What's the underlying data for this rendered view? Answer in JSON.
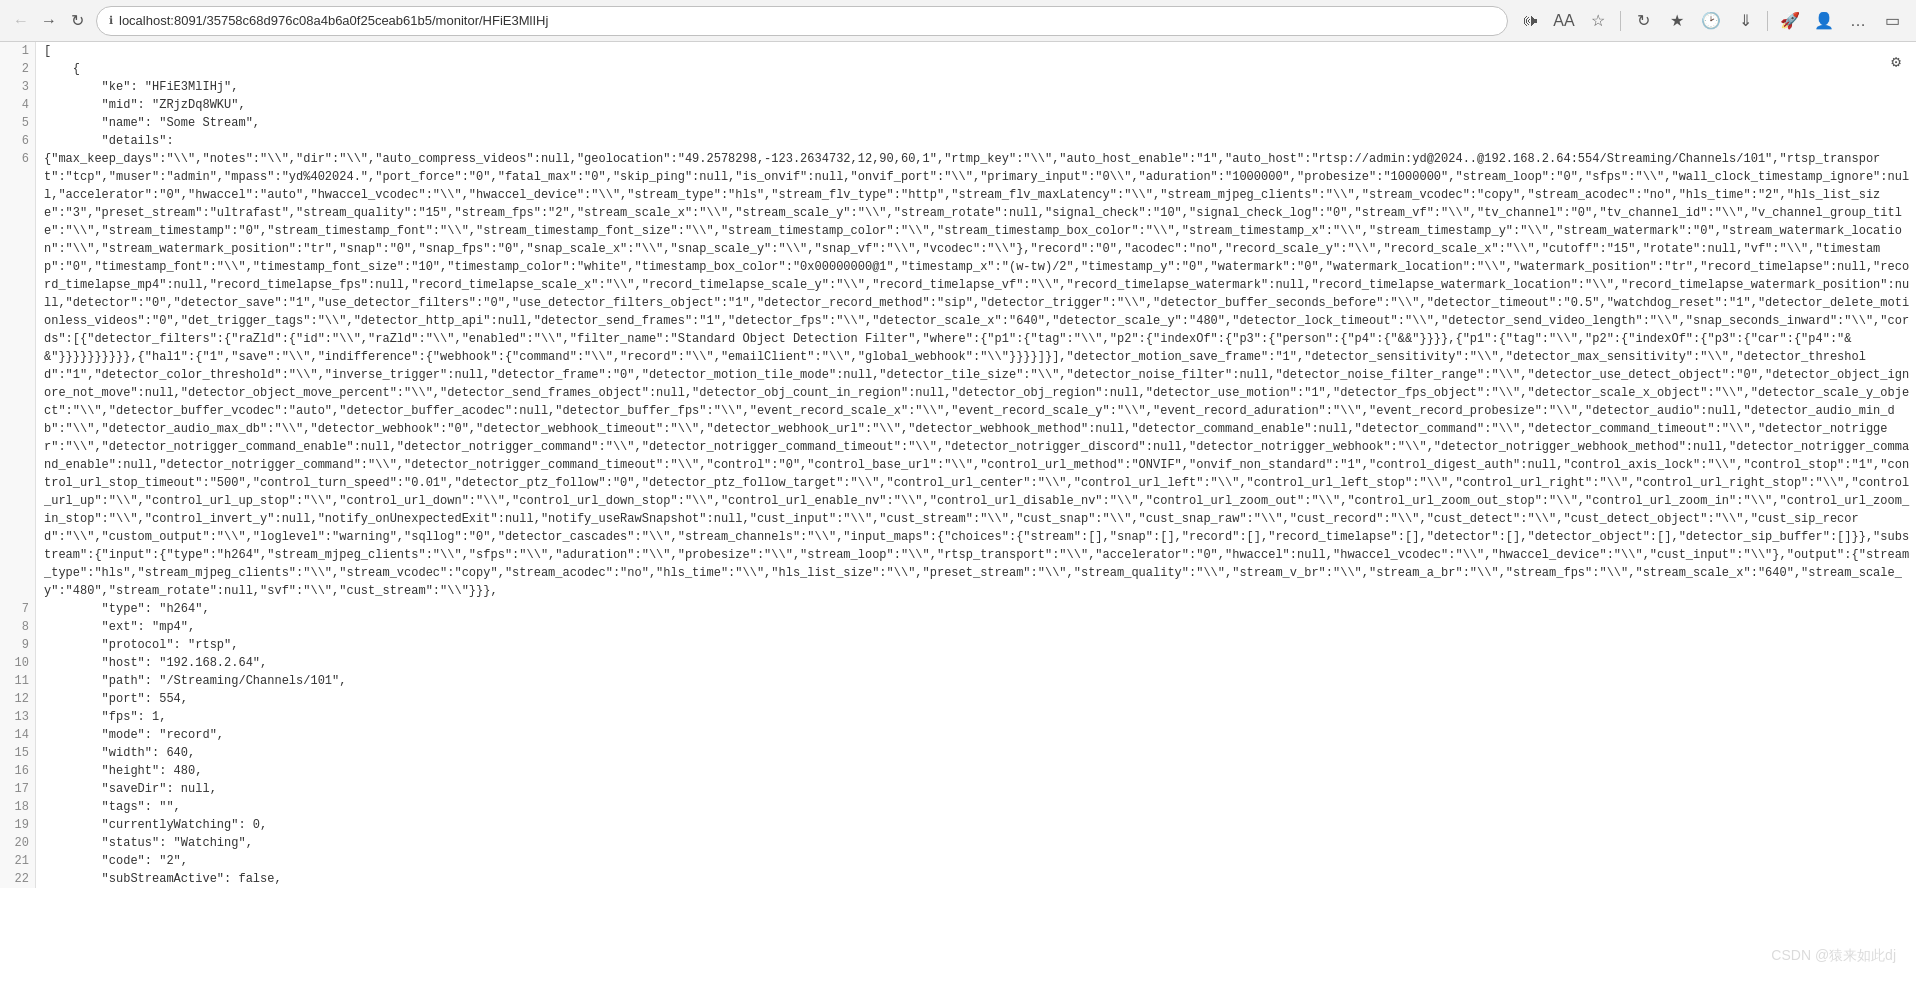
{
  "browser": {
    "url": "localhost:8091/35758c68d976c08a4b6a0f25ceab61b5/monitor/HFiE3MlIHj",
    "title": "localhost:8091/35758c68d976c08a4b6a0f25ceab61b5/monitor/HFiE3MlIHj"
  },
  "toolbar": {
    "back_disabled": true,
    "forward_disabled": false
  },
  "watermark": "CSDN @猿来如此dj",
  "json_lines": [
    {
      "num": 1,
      "content": "["
    },
    {
      "num": 2,
      "content": "    {"
    },
    {
      "num": 3,
      "content": "        \"ke\": \"HFiE3MlIHj\","
    },
    {
      "num": 4,
      "content": "        \"mid\": \"ZRjzDq8WKU\","
    },
    {
      "num": 5,
      "content": "        \"name\": \"Some Stream\","
    },
    {
      "num": 6,
      "content": "        \"details\":"
    },
    {
      "num": 6,
      "content": "{\"max_keep_days\":\"\\\\\",\"notes\":\"\\\\\",\"dir\":\"\\\\\",\"auto_compress_videos\":null,\"geolocation\":\"49.2578298,-123.2634732,12,90,60,1\",\"rtmp_key\":\"\\\\\",\"auto_host_enable\":\"1\",\"auto_host\":\"rtsp://admin:yd@2024..@192.168.2.64:554/Streaming/Channels/101\",\"rtsp_transport\":\"tcp\",\"muser\":\"admin\",\"mpass\":\"yd%402024.\",\"port_force\":\"0\",\"fatal_max\":\"0\",\"skip_ping\":null,\"is_onvif\":null,\"onvif_port\":\"\\\\\",\"primary_input\":\"0\\\\\",\"aduration\":\"1000000\",\"probesize\":\"1000000\",\"stream_loop\":\"0\",\"sfps\":\"\\\\\",\"wall_clock_timestamp_ignore\":null,\"accelerator\":\"0\",\"hwaccel\":\"auto\",\"hwaccel_vcodec\":\"\\\\\",\"hwaccel_device\":\"\\\\\",\"stream_type\":\"hls\",\"stream_flv_type\":\"http\",\"stream_flv_maxLatency\":\"\\\\\",\"stream_mjpeg_clients\":\"\\\\\",\"stream_vcodec\":\"copy\",\"stream_acodec\":\"no\",\"hls_time\":\"2\",\"hls_list_size\":\"3\",\"preset_stream\":\"ultrafast\",\"stream_quality\":\"15\",\"stream_fps\":\"2\",\"stream_scale_x\":\"\\\\\",\"stream_scale_y\":\"\\\\\",\"stream_rotate\":null,\"signal_check\":\"10\",\"signal_check_log\":\"0\",\"stream_vf\":\"\\\\\",\"tv_channel\":\"0\",\"tv_channel_id\":\"\\\\\",\"v_channel_group_title\":\"\\\\\",\"stream_timestamp\":\"0\",\"stream_timestamp_font\":\"\\\\\",\"stream_timestamp_font_size\":\"\\\\\",\"stream_timestamp_color\":\"\\\\\",\"stream_timestamp_box_color\":\"\\\\\",\"stream_timestamp_x\":\"\\\\\",\"stream_timestamp_y\":\"\\\\\",\"stream_watermark\":\"0\",\"stream_watermark_location\":\"\\\\\",\"stream_watermark_position\":\"tr\",\"snap\":\"0\",\"snap_fps\":\"0\",\"snap_scale_x\":\"\\\\\",\"snap_scale_y\":\"\\\\\",\"snap_vf\":\"\\\\\",\"vcodec\":\"\\\\\"},\"record\":\"0\",\"acodec\":\"no\",\"record_scale_y\":\"\\\\\",\"record_scale_x\":\"\\\\\",\"cutoff\":\"15\",\"rotate\":null,\"vf\":\"\\\\\",\"timestamp\":\"0\",\"timestamp_font\":\"\\\\\",\"timestamp_font_size\":\"10\",\"timestamp_color\":\"white\",\"timestamp_box_color\":\"0x00000000@1\",\"timestamp_x\":\"(w-tw)/2\",\"timestamp_y\":\"0\",\"watermark\":\"0\",\"watermark_location\":\"\\\\\",\"watermark_position\":\"tr\",\"record_timelapse\":null,\"record_timelapse_mp4\":null,\"record_timelapse_fps\":null,\"record_timelapse_scale_x\":\"\\\\\",\"record_timelapse_scale_y\":\"\\\\\",\"record_timelapse_vf\":\"\\\\\",\"record_timelapse_watermark\":null,\"record_timelapse_watermark_location\":\"\\\\\",\"record_timelapse_watermark_position\":null,\"detector\":\"0\",\"detector_save\":\"1\",\"use_detector_filters\":\"0\",\"use_detector_filters_object\":\"1\",\"detector_record_method\":\"sip\",\"detector_trigger\":\"\\\\\",\"detector_buffer_seconds_before\":\"\\\\\",\"detector_timeout\":\"0.5\",\"watchdog_reset\":\"1\",\"detector_delete_motionless_videos\":\"0\",\"det_trigger_tags\":\"\\\\\",\"detector_http_api\":null,\"detector_send_frames\":\"1\",\"detector_fps\":\"\\\\\",\"detector_scale_x\":\"640\",\"detector_scale_y\":\"480\",\"detector_lock_timeout\":\"\\\\\",\"detector_send_video_length\":\"\\\\\",\"snap_seconds_inward\":\"\\\\\",\"cords\":[{\"detector_filters\":{\"raZld\":{\"id\":\"\\\\\",\"raZld\":\"\\\\\",\"enabled\":\"\\\\\",\"filter_name\":\"Standard Object Detection Filter\",\"where\":{\"p1\":{\"tag\":\"\\\\\",\"p2\":{\"indexOf\":{\"p3\":{\"person\":{\"p4\":{\"&&\"}}}},{\"p1\":{\"tag\":\"\\\\\",\"p2\":{\"indexOf\":{\"p3\":{\"car\":{\"p4\":\"&&\"}}}}}}}}}},{\"hal1\":{\"1\",\"save\":\"\\\\\",\"indifference\":{\"webhook\":{\"command\":\"\\\\\",\"record\":\"\\\\\",\"emailClient\":\"\\\\\",\"global_webhook\":\"\\\\\"}}}}]}],\"detector_motion_save_frame\":\"1\",\"detector_sensitivity\":\"\\\\\",\"detector_max_sensitivity\":\"\\\\\",\"detector_threshold\":\"1\",\"detector_color_threshold\":\"\\\\\",\"inverse_trigger\":null,\"detector_frame\":\"0\",\"detector_motion_tile_mode\":null,\"detector_tile_size\":\"\\\\\",\"detector_noise_filter\":null,\"detector_noise_filter_range\":\"\\\\\",\"detector_use_detect_object\":\"0\",\"detector_object_ignore_not_move\":null,\"detector_object_move_percent\":\"\\\\\",\"detector_send_frames_object\":null,\"detector_obj_count_in_region\":null,\"detector_obj_region\":null,\"detector_use_motion\":\"1\",\"detector_fps_object\":\"\\\\\",\"detector_scale_x_object\":\"\\\\\",\"detector_scale_y_object\":\"\\\\\",\"detector_buffer_vcodec\":\"auto\",\"detector_buffer_acodec\":null,\"detector_buffer_fps\":\"\\\\\",\"event_record_scale_x\":\"\\\\\",\"event_record_scale_y\":\"\\\\\",\"event_record_aduration\":\"\\\\\",\"event_record_probesize\":\"\\\\\",\"detector_audio\":null,\"detector_audio_min_db\":\"\\\\\",\"detector_audio_max_db\":\"\\\\\",\"detector_webhook\":\"0\",\"detector_webhook_timeout\":\"\\\\\",\"detector_webhook_url\":\"\\\\\",\"detector_webhook_method\":null,\"detector_command_enable\":null,\"detector_command\":\"\\\\\",\"detector_command_timeout\":\"\\\\\",\"detector_notrigger\":\"\\\\\",\"detector_notrigger_command_enable\":null,\"detector_notrigger_command\":\"\\\\\",\"detector_notrigger_command_timeout\":\"\\\\\",\"detector_notrigger_discord\":null,\"detector_notrigger_webhook\":\"\\\\\",\"detector_notrigger_webhook_method\":null,\"detector_notrigger_command_enable\":null,\"detector_notrigger_command\":\"\\\\\",\"detector_notrigger_command_timeout\":\"\\\\\",\"control\":\"0\",\"control_base_url\":\"\\\\\",\"control_url_method\":\"ONVIF\",\"onvif_non_standard\":\"1\",\"control_digest_auth\":null,\"control_axis_lock\":\"\\\\\",\"control_stop\":\"1\",\"control_url_stop_timeout\":\"500\",\"control_turn_speed\":\"0.01\",\"detector_ptz_follow\":\"0\",\"detector_ptz_follow_target\":\"\\\\\",\"control_url_center\":\"\\\\\",\"control_url_left\":\"\\\\\",\"control_url_left_stop\":\"\\\\\",\"control_url_right\":\"\\\\\",\"control_url_right_stop\":\"\\\\\",\"control_url_up\":\"\\\\\",\"control_url_up_stop\":\"\\\\\",\"control_url_down\":\"\\\\\",\"control_url_down_stop\":\"\\\\\",\"control_url_enable_nv\":\"\\\\\",\"control_url_disable_nv\":\"\\\\\",\"control_url_zoom_out\":\"\\\\\",\"control_url_zoom_out_stop\":\"\\\\\",\"control_url_zoom_in\":\"\\\\\",\"control_url_zoom_in_stop\":\"\\\\\",\"control_invert_y\":null,\"notify_onUnexpectedExit\":null,\"notify_useRawSnapshot\":null,\"cust_input\":\"\\\\\",\"cust_stream\":\"\\\\\",\"cust_snap\":\"\\\\\",\"cust_snap_raw\":\"\\\\\",\"cust_record\":\"\\\\\",\"cust_detect\":\"\\\\\",\"cust_detect_object\":\"\\\\\",\"cust_sip_record\":\"\\\\\",\"custom_output\":\"\\\\\",\"loglevel\":\"warning\",\"sqllog\":\"0\",\"detector_cascades\":\"\\\\\",\"stream_channels\":\"\\\\\",\"input_maps\":{\"choices\":{\"stream\":[],\"snap\":[],\"record\":[],\"record_timelapse\":[],\"detector\":[],\"detector_object\":[],\"detector_sip_buffer\":[]}},\"substream\":{\"input\":{\"type\":\"h264\",\"stream_mjpeg_clients\":\"\\\\\",\"sfps\":\"\\\\\",\"aduration\":\"\\\\\",\"probesize\":\"\\\\\",\"stream_loop\":\"\\\\\",\"rtsp_transport\":\"\\\\\",\"accelerator\":\"0\",\"hwaccel\":null,\"hwaccel_vcodec\":\"\\\\\",\"hwaccel_device\":\"\\\\\",\"cust_input\":\"\\\\\"},\"output\":{\"stream_type\":\"hls\",\"stream_mjpeg_clients\":\"\\\\\",\"stream_vcodec\":\"copy\",\"stream_acodec\":\"no\",\"hls_time\":\"\\\\\",\"hls_list_size\":\"\\\\\",\"preset_stream\":\"\\\\\",\"stream_quality\":\"\\\\\",\"stream_v_br\":\"\\\\\",\"stream_a_br\":\"\\\\\",\"stream_fps\":\"\\\\\",\"stream_scale_x\":\"640\",\"stream_scale_y\":\"480\",\"stream_rotate\":null,\"svf\":\"\\\\\",\"cust_stream\":\"\\\\\"}}},"
    },
    {
      "num": 7,
      "content": "        \"type\": \"h264\","
    },
    {
      "num": 8,
      "content": "        \"ext\": \"mp4\","
    },
    {
      "num": 9,
      "content": "        \"protocol\": \"rtsp\","
    },
    {
      "num": 10,
      "content": "        \"host\": \"192.168.2.64\","
    },
    {
      "num": 11,
      "content": "        \"path\": \"/Streaming/Channels/101\","
    },
    {
      "num": 12,
      "content": "        \"port\": 554,"
    },
    {
      "num": 13,
      "content": "        \"fps\": 1,"
    },
    {
      "num": 14,
      "content": "        \"mode\": \"record\","
    },
    {
      "num": 15,
      "content": "        \"width\": 640,"
    },
    {
      "num": 16,
      "content": "        \"height\": 480,"
    },
    {
      "num": 17,
      "content": "        \"saveDir\": null,"
    },
    {
      "num": 18,
      "content": "        \"tags\": \"\","
    },
    {
      "num": 19,
      "content": "        \"currentlyWatching\": 0,"
    },
    {
      "num": 20,
      "content": "        \"status\": \"Watching\","
    },
    {
      "num": 21,
      "content": "        \"code\": \"2\","
    },
    {
      "num": 22,
      "content": "        \"subStreamActive\": false,"
    }
  ]
}
